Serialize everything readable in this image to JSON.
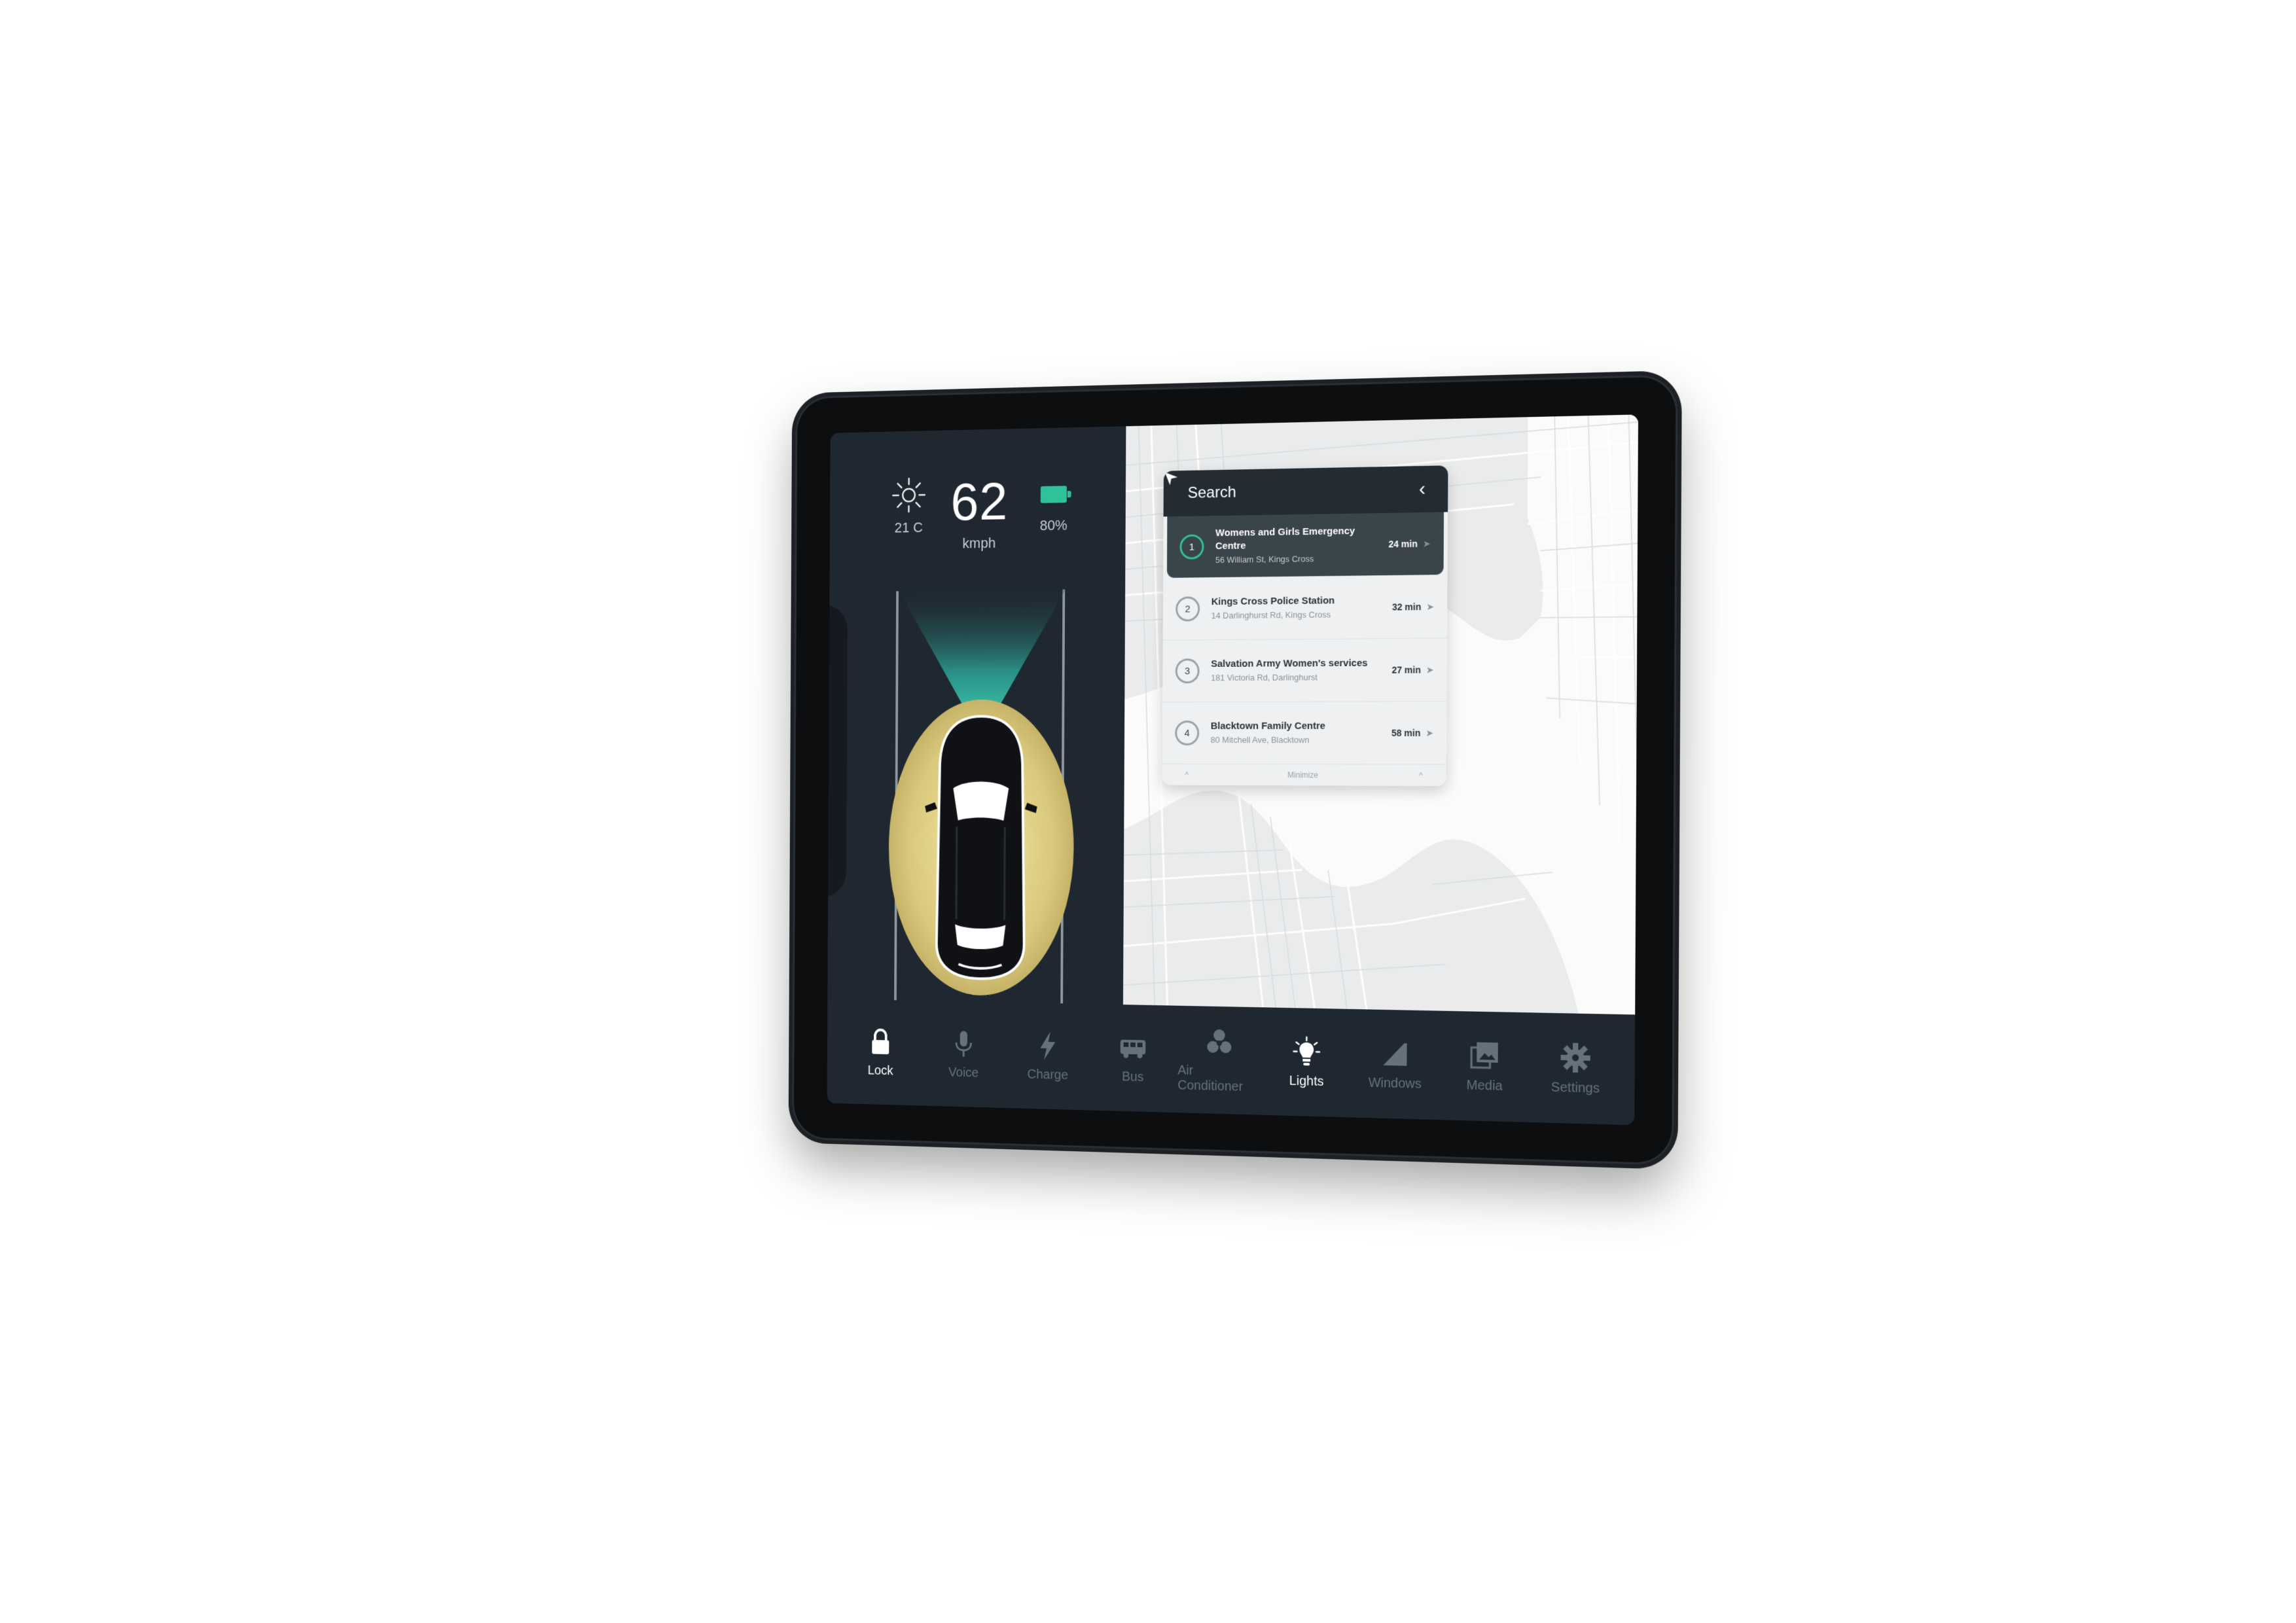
{
  "dashboard": {
    "temperature": "21 C",
    "speed": "62",
    "speed_unit": "kmph",
    "battery": "80%",
    "battery_level": 0.8
  },
  "search": {
    "label": "Search",
    "results": [
      {
        "index": "1",
        "title": "Womens and Girls Emergency Centre",
        "address": "56 William St, Kings Cross",
        "time": "24 min"
      },
      {
        "index": "2",
        "title": "Kings Cross Police Station",
        "address": "14 Darlinghurst Rd, Kings Cross",
        "time": "32 min"
      },
      {
        "index": "3",
        "title": "Salvation Army Women's services",
        "address": "181 Victoria Rd, Darlinghurst",
        "time": "27 min"
      },
      {
        "index": "4",
        "title": "Blacktown Family Centre",
        "address": "80 Mitchell Ave, Blacktown",
        "time": "58 min"
      }
    ],
    "minimize_label": "Minimize"
  },
  "nav": [
    {
      "label": "Lock",
      "icon": "lock-icon",
      "active": true
    },
    {
      "label": "Voice",
      "icon": "microphone-icon",
      "active": false
    },
    {
      "label": "Charge",
      "icon": "lightning-icon",
      "active": false
    },
    {
      "label": "Bus",
      "icon": "bus-icon",
      "active": false
    },
    {
      "label": "Air Conditioner",
      "icon": "fan-icon",
      "active": false
    },
    {
      "label": "Lights",
      "icon": "bulb-icon",
      "active": true
    },
    {
      "label": "Windows",
      "icon": "window-icon",
      "active": false
    },
    {
      "label": "Media",
      "icon": "media-icon",
      "active": false
    },
    {
      "label": "Settings",
      "icon": "gear-icon",
      "active": false
    }
  ],
  "colors": {
    "accent": "#2fc19a",
    "panel": "#1f2830",
    "bezel": "#0c0e10"
  }
}
